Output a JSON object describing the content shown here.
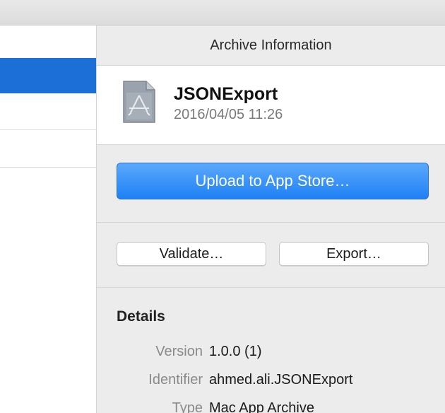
{
  "inspector": {
    "title": "Archive Information",
    "archive": {
      "icon": "app-archive-icon",
      "name": "JSONExport",
      "date": "2016/04/05 11:26"
    },
    "upload_label": "Upload to App Store…",
    "validate_label": "Validate…",
    "export_label": "Export…",
    "details": {
      "title": "Details",
      "rows": [
        {
          "label": "Version",
          "value": "1.0.0 (1)"
        },
        {
          "label": "Identifier",
          "value": "ahmed.ali.JSONExport"
        },
        {
          "label": "Type",
          "value": "Mac App Archive"
        }
      ]
    }
  },
  "colors": {
    "selection": "#1d6fd8",
    "primary_button": "#1f80f5"
  }
}
